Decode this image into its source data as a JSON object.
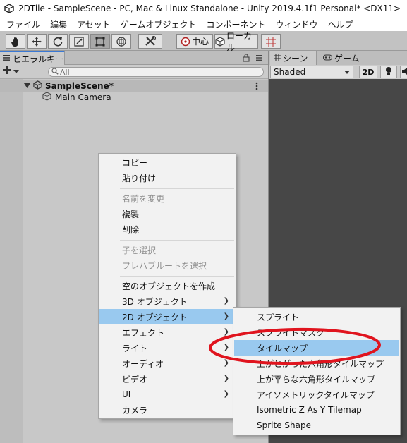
{
  "window": {
    "title": "2DTile - SampleScene - PC, Mac & Linux Standalone - Unity 2019.4.1f1 Personal* <DX11>"
  },
  "menubar": {
    "items": [
      "ファイル",
      "編集",
      "アセット",
      "ゲームオブジェクト",
      "コンポーネント",
      "ウィンドウ",
      "ヘルプ"
    ]
  },
  "toolbar": {
    "pivot_label": "中心",
    "space_label": "ローカル"
  },
  "hierarchy": {
    "tab_label": "ヒエラルキー",
    "search_placeholder": "All",
    "scene_name": "SampleScene*",
    "objects": [
      "Main Camera"
    ]
  },
  "scene_panel": {
    "tabs": [
      "シーン",
      "ゲーム"
    ],
    "shading_mode": "Shaded",
    "mode_2d": "2D"
  },
  "context_menu": {
    "items": [
      {
        "label": "コピー",
        "enabled": true
      },
      {
        "label": "貼り付け",
        "enabled": true
      },
      {
        "label": "名前を変更",
        "enabled": false
      },
      {
        "label": "複製",
        "enabled": true
      },
      {
        "label": "削除",
        "enabled": true
      },
      {
        "label": "子を選択",
        "enabled": false
      },
      {
        "label": "プレハブルートを選択",
        "enabled": false
      },
      {
        "label": "空のオブジェクトを作成",
        "enabled": true
      },
      {
        "label": "3D オブジェクト",
        "enabled": true,
        "submenu": true
      },
      {
        "label": "2D オブジェクト",
        "enabled": true,
        "submenu": true,
        "highlighted": true
      },
      {
        "label": "エフェクト",
        "enabled": true,
        "submenu": true
      },
      {
        "label": "ライト",
        "enabled": true,
        "submenu": true
      },
      {
        "label": "オーディオ",
        "enabled": true,
        "submenu": true
      },
      {
        "label": "ビデオ",
        "enabled": true,
        "submenu": true
      },
      {
        "label": "UI",
        "enabled": true,
        "submenu": true
      },
      {
        "label": "カメラ",
        "enabled": true
      }
    ]
  },
  "submenu_2d": {
    "items": [
      {
        "label": "スプライト"
      },
      {
        "label": "スプライトマスク"
      },
      {
        "label": "タイルマップ",
        "highlighted": true
      },
      {
        "label": "上がとがった六角形タイルマップ"
      },
      {
        "label": "上が平らな六角形タイルマップ"
      },
      {
        "label": "アイソメトリックタイルマップ"
      },
      {
        "label": "Isometric Z As Y Tilemap"
      },
      {
        "label": "Sprite Shape"
      }
    ]
  },
  "colors": {
    "highlight": "#99c9ef",
    "annotation": "#e0141e",
    "scene_bg": "#474747",
    "tab_accent": "#3a79d5"
  }
}
